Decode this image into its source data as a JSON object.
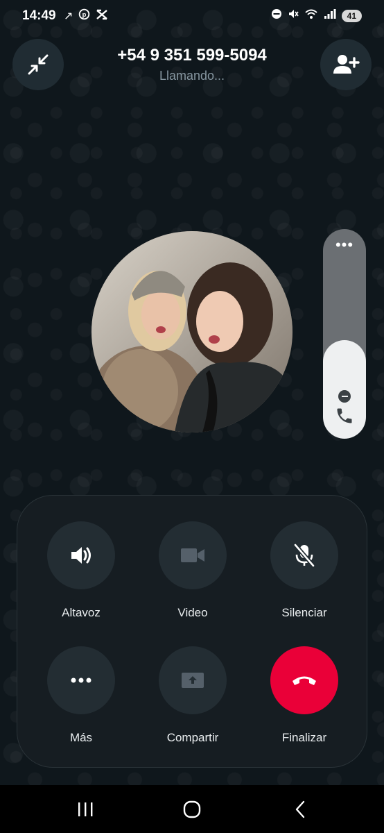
{
  "status_bar": {
    "time": "14:49",
    "left_icons": [
      "arrow-up-right-icon",
      "pinterest-icon",
      "capcut-icon"
    ],
    "right_icons": [
      "do-not-disturb-icon",
      "mute-icon",
      "wifi-5-icon",
      "signal-icon"
    ],
    "battery": "41"
  },
  "call": {
    "number": "+54 9 351 599-5094",
    "status": "Llamando..."
  },
  "volume": {
    "level": 0.47,
    "dots": "•••"
  },
  "controls": {
    "speaker_label": "Altavoz",
    "video_label": "Video",
    "mute_label": "Silenciar",
    "more_label": "Más",
    "share_label": "Compartir",
    "end_label": "Finalizar"
  },
  "colors": {
    "background": "#0f171c",
    "panel": "#161d22",
    "button": "#232d33",
    "end_call": "#ea0038"
  }
}
